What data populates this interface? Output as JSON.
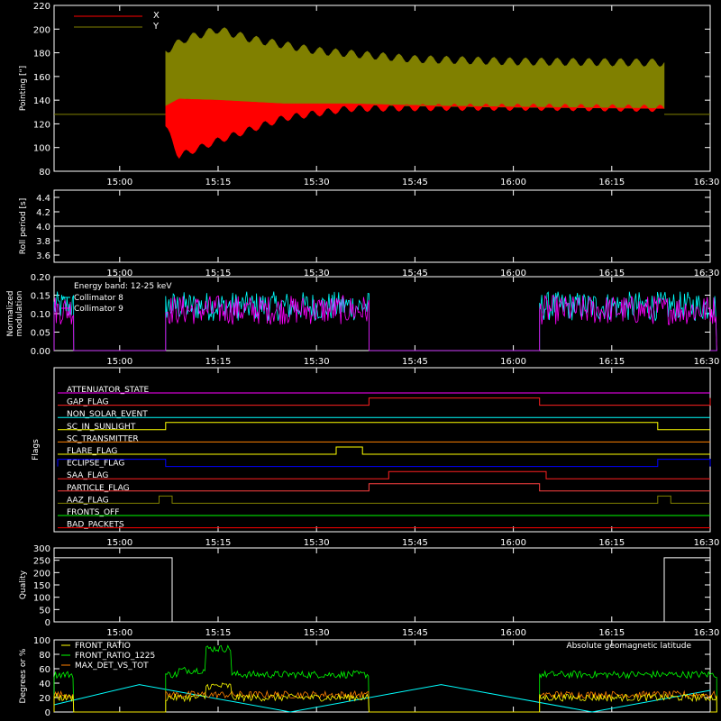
{
  "time_ticks": [
    "15:00",
    "15:15",
    "15:30",
    "15:45",
    "16:00",
    "16:15",
    "16:30"
  ],
  "time_axis": {
    "start": "14:50",
    "end": "16:30",
    "tick_values": [
      "15:00",
      "15:15",
      "15:30",
      "15:45",
      "16:00",
      "16:15",
      "16:30"
    ]
  },
  "chart_data": [
    {
      "type": "area",
      "panel": "pointing",
      "ylabel": "Pointing [\"]",
      "ylim": [
        80,
        220
      ],
      "yticks": [
        80,
        100,
        120,
        140,
        160,
        180,
        200,
        220
      ],
      "baseline_value": 128,
      "active_interval": [
        "15:07",
        "16:23"
      ],
      "series": [
        {
          "name": "X",
          "color": "#ff0000",
          "envelope_time": [
            "15:07",
            "15:09",
            "15:15",
            "15:25",
            "15:35",
            "15:50",
            "16:05",
            "16:23"
          ],
          "upper": [
            135,
            141,
            140,
            137,
            137,
            135,
            134,
            133
          ],
          "lower": [
            115,
            90,
            103,
            122,
            130,
            131,
            131,
            130
          ]
        },
        {
          "name": "Y",
          "color": "#808000",
          "envelope_time": [
            "15:07",
            "15:10",
            "15:15",
            "15:20",
            "15:30",
            "15:45",
            "16:00",
            "16:23"
          ],
          "upper": [
            185,
            195,
            203,
            195,
            185,
            178,
            176,
            175
          ],
          "lower": [
            135,
            141,
            140,
            137,
            137,
            135,
            134,
            133
          ]
        }
      ]
    },
    {
      "type": "line",
      "panel": "roll_period",
      "ylabel": "Roll period [s]",
      "ylim": [
        3.5,
        4.5
      ],
      "yticks": [
        3.6,
        3.8,
        4.0,
        4.2,
        4.4
      ],
      "series": [
        {
          "name": "",
          "color": "#ffffff",
          "x": [
            "14:50",
            "16:30"
          ],
          "y": [
            4.0,
            4.0
          ]
        }
      ]
    },
    {
      "type": "line",
      "panel": "modulation",
      "ylabel": "Normalized modulation",
      "ylim": [
        0,
        0.2
      ],
      "yticks": [
        "0.00",
        "0.05",
        "0.10",
        "0.15",
        "0.20"
      ],
      "annotation": "Energy band: 12-25 keV",
      "active_intervals": [
        [
          "14:50",
          "14:53"
        ],
        [
          "15:07",
          "15:38"
        ],
        [
          "16:04",
          "16:31"
        ]
      ],
      "series": [
        {
          "name": "Collimator 8",
          "color": "#00ffff",
          "mean": 0.12,
          "spread": 0.04
        },
        {
          "name": "Collimator 9",
          "color": "#ff00ff",
          "mean": 0.11,
          "spread": 0.04
        }
      ]
    },
    {
      "type": "line",
      "panel": "flags",
      "ylabel": "Flags",
      "flags": [
        {
          "name": "ATTENUATOR_STATE",
          "color": "#ff00ff",
          "on": []
        },
        {
          "name": "GAP_FLAG",
          "color": "#ff2020",
          "on": [
            [
              "15:38",
              "16:04"
            ],
            [
              "16:30",
              "16:31"
            ]
          ]
        },
        {
          "name": "NON_SOLAR_EVENT",
          "color": "#00ffff",
          "on": []
        },
        {
          "name": "SC_IN_SUNLIGHT",
          "color": "#ffff00",
          "on": [
            [
              "15:07",
              "16:22"
            ]
          ]
        },
        {
          "name": "SC_TRANSMITTER",
          "color": "#ff8000",
          "on": []
        },
        {
          "name": "FLARE_FLAG",
          "color": "#ffff00",
          "on": [
            [
              "15:33",
              "15:37"
            ]
          ]
        },
        {
          "name": "ECLIPSE_FLAG",
          "color": "#0000ff",
          "on": [
            [
              "14:50",
              "15:07"
            ],
            [
              "16:22",
              "16:31"
            ]
          ]
        },
        {
          "name": "SAA_FLAG",
          "color": "#ff2020",
          "on": [
            [
              "15:41",
              "16:05"
            ]
          ]
        },
        {
          "name": "PARTICLE_FLAG",
          "color": "#ff4040",
          "on": [
            [
              "15:38",
              "16:04"
            ]
          ]
        },
        {
          "name": "AAZ_FLAG",
          "color": "#808000",
          "on": [
            [
              "15:06",
              "15:08"
            ],
            [
              "16:22",
              "16:24"
            ]
          ]
        },
        {
          "name": "FRONTS_OFF",
          "color": "#00ff00",
          "on": []
        },
        {
          "name": "BAD_PACKETS",
          "color": "#ff0000",
          "on": []
        }
      ]
    },
    {
      "type": "line",
      "panel": "quality",
      "ylabel": "Quality",
      "ylim": [
        0,
        300
      ],
      "yticks": [
        0,
        50,
        100,
        150,
        200,
        250,
        300
      ],
      "series": [
        {
          "name": "",
          "color": "#ffffff",
          "x": [
            "14:50",
            "15:08",
            "15:08",
            "16:23",
            "16:23",
            "16:30"
          ],
          "y": [
            260,
            260,
            0,
            0,
            260,
            260
          ]
        }
      ]
    },
    {
      "type": "line",
      "panel": "ratios",
      "ylabel": "Degrees or %",
      "ylim": [
        0,
        100
      ],
      "yticks": [
        0,
        20,
        40,
        60,
        80,
        100
      ],
      "active_intervals": [
        [
          "14:50",
          "14:53"
        ],
        [
          "15:07",
          "15:38"
        ],
        [
          "16:04",
          "16:31"
        ]
      ],
      "series": [
        {
          "name": "FRONT_RATIO",
          "color": "#ffff00",
          "mean": 20
        },
        {
          "name": "FRONT_RATIO_1225",
          "color": "#00ff00",
          "mean": 52
        },
        {
          "name": "MAX_DET_VS_TOT",
          "color": "#ff8000",
          "mean": 24
        },
        {
          "name": "Absolute geomagnetic latitude",
          "color": "#00ffff",
          "x": [
            "14:50",
            "15:03",
            "15:26",
            "15:49",
            "16:12",
            "16:30"
          ],
          "y": [
            10,
            38,
            0,
            38,
            0,
            30
          ]
        }
      ]
    }
  ]
}
